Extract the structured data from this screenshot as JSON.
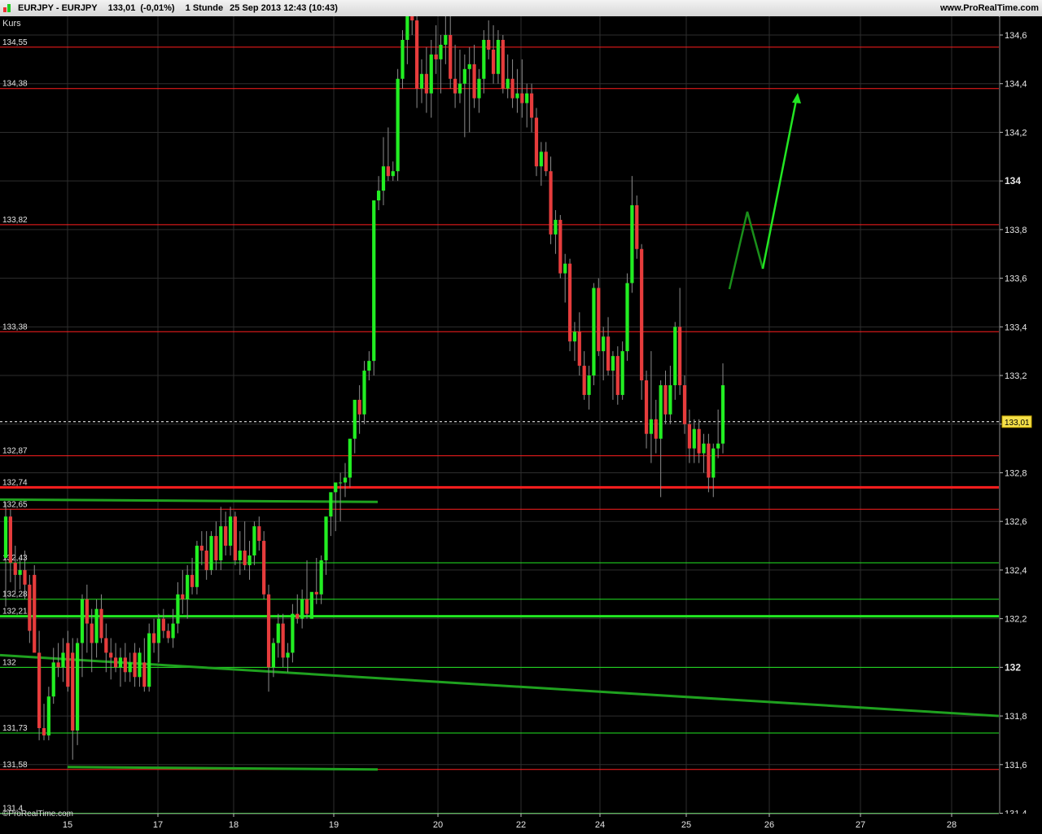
{
  "header": {
    "instrument": "EURJPY - EURJPY",
    "last": "133,01",
    "change": "(-0,01%)",
    "timeframe": "1 Stunde",
    "datetime": "25 Sep 2013 12:43 (10:43)",
    "site": "www.ProRealTime.com"
  },
  "watermark": "©ProRealTime.com",
  "chart_data": {
    "type": "candlestick",
    "title": "EURJPY - EURJPY",
    "ylabel": "Kurs",
    "ylim": [
      131.4,
      134.7
    ],
    "grid": true,
    "y_ticks": [
      {
        "value": 131.4,
        "label": "131,4"
      },
      {
        "value": 131.6,
        "label": "131,6"
      },
      {
        "value": 131.8,
        "label": "131,8"
      },
      {
        "value": 132.0,
        "label": "132",
        "bold": true
      },
      {
        "value": 132.2,
        "label": "132,2"
      },
      {
        "value": 132.4,
        "label": "132,4"
      },
      {
        "value": 132.6,
        "label": "132,6"
      },
      {
        "value": 132.8,
        "label": "132,8"
      },
      {
        "value": 133.0,
        "label": "133"
      },
      {
        "value": 133.2,
        "label": "133,2"
      },
      {
        "value": 133.4,
        "label": "133,4"
      },
      {
        "value": 133.6,
        "label": "133,6"
      },
      {
        "value": 133.8,
        "label": "133,8"
      },
      {
        "value": 134.0,
        "label": "134",
        "bold": true
      },
      {
        "value": 134.2,
        "label": "134,2"
      },
      {
        "value": 134.4,
        "label": "134,4"
      },
      {
        "value": 134.6,
        "label": "134,6"
      }
    ],
    "x_labels": [
      "15",
      "17",
      "18",
      "19",
      "20",
      "22",
      "24",
      "25",
      "26",
      "27",
      "28"
    ],
    "current_price": {
      "value": 133.01,
      "label": "133,01"
    },
    "levels": [
      {
        "value": 134.55,
        "label": "134,55",
        "color": "#ff1e1e",
        "width": 1
      },
      {
        "value": 134.38,
        "label": "134,38",
        "color": "#ff1e1e",
        "width": 1
      },
      {
        "value": 133.82,
        "label": "133,82",
        "color": "#ff1e1e",
        "width": 1
      },
      {
        "value": 133.38,
        "label": "133,38",
        "color": "#ff1e1e",
        "width": 1
      },
      {
        "value": 132.87,
        "label": "132,87",
        "color": "#ff1e1e",
        "width": 1
      },
      {
        "value": 132.74,
        "label": "132,74",
        "color": "#ff1e1e",
        "width": 3
      },
      {
        "value": 132.65,
        "label": "132,65",
        "color": "#ff1e1e",
        "width": 1
      },
      {
        "value": 132.43,
        "label": "132,43",
        "color": "#22e622",
        "width": 1
      },
      {
        "value": 132.28,
        "label": "132,28",
        "color": "#22e622",
        "width": 1
      },
      {
        "value": 132.21,
        "label": "132,21",
        "color": "#22e622",
        "width": 3
      },
      {
        "value": 132.0,
        "label": "132",
        "color": "#22e622",
        "width": 1
      },
      {
        "value": 131.73,
        "label": "131,73",
        "color": "#22e622",
        "width": 1
      },
      {
        "value": 131.58,
        "label": "131,58",
        "color": "#ff1e1e",
        "width": 1
      },
      {
        "value": 131.4,
        "label": "131,4",
        "color": "#22e622",
        "width": 1
      }
    ],
    "trendlines": [
      {
        "from": [
          "15",
          132.69
        ],
        "to": [
          "19",
          132.68
        ],
        "color": "#1fa11f",
        "width": 3
      },
      {
        "from": [
          "15",
          131.59
        ],
        "to": [
          "19",
          131.58
        ],
        "color": "#1fa11f",
        "width": 3
      },
      {
        "from": [
          "15",
          132.05
        ],
        "to": [
          "28",
          131.8
        ],
        "color": "#1fa11f",
        "width": 3
      }
    ],
    "annotations": [
      {
        "type": "projection_path",
        "points": [
          [
            "25",
            133.62
          ],
          [
            "26",
            133.94
          ],
          [
            "26",
            133.7
          ]
        ],
        "color": "#1a8f1a"
      },
      {
        "type": "arrow",
        "from": [
          "26",
          133.7
        ],
        "to": [
          "26",
          134.45
        ],
        "color": "#22e622"
      }
    ],
    "candles": [
      {
        "o": 132.45,
        "h": 132.68,
        "l": 132.25,
        "c": 132.62
      },
      {
        "o": 132.62,
        "h": 132.65,
        "l": 132.35,
        "c": 132.43
      },
      {
        "o": 132.43,
        "h": 132.5,
        "l": 132.3,
        "c": 132.38
      },
      {
        "o": 132.38,
        "h": 132.45,
        "l": 132.32,
        "c": 132.4
      },
      {
        "o": 132.4,
        "h": 132.48,
        "l": 132.28,
        "c": 132.34
      },
      {
        "o": 132.34,
        "h": 132.38,
        "l": 132.1,
        "c": 132.15
      },
      {
        "o": 132.38,
        "h": 132.42,
        "l": 132.08,
        "c": 132.06
      },
      {
        "o": 132.06,
        "h": 132.15,
        "l": 131.7,
        "c": 131.75
      },
      {
        "o": 131.75,
        "h": 131.85,
        "l": 131.7,
        "c": 131.72
      },
      {
        "o": 131.72,
        "h": 131.92,
        "l": 131.7,
        "c": 131.88
      },
      {
        "o": 131.88,
        "h": 132.08,
        "l": 131.85,
        "c": 132.02
      },
      {
        "o": 132.02,
        "h": 132.1,
        "l": 131.96,
        "c": 132.0
      },
      {
        "o": 132.0,
        "h": 132.12,
        "l": 131.94,
        "c": 132.06
      },
      {
        "o": 132.1,
        "h": 132.15,
        "l": 131.9,
        "c": 131.92
      },
      {
        "o": 132.06,
        "h": 132.12,
        "l": 131.62,
        "c": 131.74
      },
      {
        "o": 131.74,
        "h": 132.12,
        "l": 131.68,
        "c": 132.1
      },
      {
        "o": 132.1,
        "h": 132.3,
        "l": 131.96,
        "c": 132.28
      },
      {
        "o": 132.28,
        "h": 132.34,
        "l": 132.06,
        "c": 132.18
      },
      {
        "o": 132.18,
        "h": 132.24,
        "l": 131.98,
        "c": 132.1
      },
      {
        "o": 132.1,
        "h": 132.28,
        "l": 132.04,
        "c": 132.24
      },
      {
        "o": 132.24,
        "h": 132.3,
        "l": 132.1,
        "c": 132.12
      },
      {
        "o": 132.12,
        "h": 132.18,
        "l": 131.98,
        "c": 132.06
      },
      {
        "o": 132.06,
        "h": 132.12,
        "l": 131.95,
        "c": 132.04
      },
      {
        "o": 132.04,
        "h": 132.1,
        "l": 131.98,
        "c": 132.0
      },
      {
        "o": 132.0,
        "h": 132.08,
        "l": 131.92,
        "c": 132.04
      },
      {
        "o": 132.04,
        "h": 132.1,
        "l": 131.94,
        "c": 131.98
      },
      {
        "o": 131.98,
        "h": 132.06,
        "l": 131.94,
        "c": 132.02
      },
      {
        "o": 132.06,
        "h": 132.1,
        "l": 131.92,
        "c": 131.96
      },
      {
        "o": 131.96,
        "h": 132.08,
        "l": 131.92,
        "c": 132.06
      },
      {
        "o": 132.02,
        "h": 132.12,
        "l": 131.9,
        "c": 131.92
      },
      {
        "o": 131.92,
        "h": 132.18,
        "l": 131.9,
        "c": 132.14
      },
      {
        "o": 132.14,
        "h": 132.2,
        "l": 132.06,
        "c": 132.1
      },
      {
        "o": 132.1,
        "h": 132.22,
        "l": 132.02,
        "c": 132.2
      },
      {
        "o": 132.2,
        "h": 132.24,
        "l": 132.12,
        "c": 132.15
      },
      {
        "o": 132.15,
        "h": 132.18,
        "l": 132.1,
        "c": 132.12
      },
      {
        "o": 132.12,
        "h": 132.24,
        "l": 132.08,
        "c": 132.18
      },
      {
        "o": 132.18,
        "h": 132.35,
        "l": 132.14,
        "c": 132.3
      },
      {
        "o": 132.3,
        "h": 132.4,
        "l": 132.22,
        "c": 132.28
      },
      {
        "o": 132.28,
        "h": 132.42,
        "l": 132.2,
        "c": 132.38
      },
      {
        "o": 132.38,
        "h": 132.45,
        "l": 132.3,
        "c": 132.33
      },
      {
        "o": 132.33,
        "h": 132.52,
        "l": 132.3,
        "c": 132.5
      },
      {
        "o": 132.5,
        "h": 132.56,
        "l": 132.42,
        "c": 132.48
      },
      {
        "o": 132.48,
        "h": 132.56,
        "l": 132.36,
        "c": 132.4
      },
      {
        "o": 132.4,
        "h": 132.56,
        "l": 132.38,
        "c": 132.54
      },
      {
        "o": 132.54,
        "h": 132.6,
        "l": 132.4,
        "c": 132.44
      },
      {
        "o": 132.44,
        "h": 132.66,
        "l": 132.4,
        "c": 132.58
      },
      {
        "o": 132.58,
        "h": 132.64,
        "l": 132.46,
        "c": 132.5
      },
      {
        "o": 132.5,
        "h": 132.66,
        "l": 132.46,
        "c": 132.62
      },
      {
        "o": 132.62,
        "h": 132.64,
        "l": 132.42,
        "c": 132.44
      },
      {
        "o": 132.44,
        "h": 132.56,
        "l": 132.38,
        "c": 132.48
      },
      {
        "o": 132.48,
        "h": 132.6,
        "l": 132.4,
        "c": 132.42
      },
      {
        "o": 132.42,
        "h": 132.52,
        "l": 132.36,
        "c": 132.46
      },
      {
        "o": 132.46,
        "h": 132.6,
        "l": 132.42,
        "c": 132.58
      },
      {
        "o": 132.58,
        "h": 132.62,
        "l": 132.48,
        "c": 132.52
      },
      {
        "o": 132.52,
        "h": 132.56,
        "l": 132.28,
        "c": 132.3
      },
      {
        "o": 132.3,
        "h": 132.34,
        "l": 131.9,
        "c": 132.0
      },
      {
        "o": 132.0,
        "h": 132.12,
        "l": 131.96,
        "c": 132.1
      },
      {
        "o": 132.1,
        "h": 132.22,
        "l": 132.04,
        "c": 132.18
      },
      {
        "o": 132.18,
        "h": 132.22,
        "l": 132.0,
        "c": 132.04
      },
      {
        "o": 132.04,
        "h": 132.1,
        "l": 131.98,
        "c": 132.06
      },
      {
        "o": 132.06,
        "h": 132.26,
        "l": 132.02,
        "c": 132.22
      },
      {
        "o": 132.22,
        "h": 132.3,
        "l": 132.18,
        "c": 132.2
      },
      {
        "o": 132.2,
        "h": 132.32,
        "l": 132.16,
        "c": 132.28
      },
      {
        "o": 132.28,
        "h": 132.44,
        "l": 132.2,
        "c": 132.22
      },
      {
        "o": 132.2,
        "h": 132.3,
        "l": 132.2,
        "c": 132.31
      },
      {
        "o": 132.31,
        "h": 132.45,
        "l": 132.26,
        "c": 132.3
      },
      {
        "o": 132.3,
        "h": 132.46,
        "l": 132.26,
        "c": 132.44
      },
      {
        "o": 132.44,
        "h": 132.6,
        "l": 132.38,
        "c": 132.62
      },
      {
        "o": 132.62,
        "h": 132.7,
        "l": 132.54,
        "c": 132.72
      },
      {
        "o": 132.72,
        "h": 132.74,
        "l": 132.56,
        "c": 132.76
      },
      {
        "o": 132.76,
        "h": 132.8,
        "l": 132.6,
        "c": 132.76
      },
      {
        "o": 132.76,
        "h": 132.84,
        "l": 132.7,
        "c": 132.78
      },
      {
        "o": 132.78,
        "h": 132.9,
        "l": 132.74,
        "c": 132.94
      },
      {
        "o": 132.94,
        "h": 133.04,
        "l": 132.88,
        "c": 133.1
      },
      {
        "o": 133.1,
        "h": 133.16,
        "l": 132.96,
        "c": 133.04
      },
      {
        "o": 133.04,
        "h": 133.26,
        "l": 133.0,
        "c": 133.22
      },
      {
        "o": 133.22,
        "h": 133.3,
        "l": 133.18,
        "c": 133.26
      },
      {
        "o": 133.26,
        "h": 133.92,
        "l": 133.2,
        "c": 133.92
      },
      {
        "o": 133.92,
        "h": 134.02,
        "l": 133.88,
        "c": 133.96
      },
      {
        "o": 133.96,
        "h": 134.18,
        "l": 133.9,
        "c": 134.06
      },
      {
        "o": 134.06,
        "h": 134.22,
        "l": 134.0,
        "c": 134.02
      },
      {
        "o": 134.02,
        "h": 134.08,
        "l": 134.0,
        "c": 134.04
      },
      {
        "o": 134.04,
        "h": 134.46,
        "l": 134.0,
        "c": 134.42
      },
      {
        "o": 134.42,
        "h": 134.62,
        "l": 134.38,
        "c": 134.58
      },
      {
        "o": 134.58,
        "h": 134.7,
        "l": 134.48,
        "c": 134.68
      },
      {
        "o": 134.68,
        "h": 134.72,
        "l": 134.6,
        "c": 134.66
      },
      {
        "o": 134.66,
        "h": 134.7,
        "l": 134.3,
        "c": 134.38
      },
      {
        "o": 134.38,
        "h": 134.5,
        "l": 134.32,
        "c": 134.44
      },
      {
        "o": 134.44,
        "h": 134.55,
        "l": 134.28,
        "c": 134.36
      },
      {
        "o": 134.36,
        "h": 134.58,
        "l": 134.26,
        "c": 134.52
      },
      {
        "o": 134.52,
        "h": 134.64,
        "l": 134.44,
        "c": 134.5
      },
      {
        "o": 134.5,
        "h": 134.6,
        "l": 134.36,
        "c": 134.56
      },
      {
        "o": 134.56,
        "h": 134.7,
        "l": 134.48,
        "c": 134.6
      },
      {
        "o": 134.6,
        "h": 134.72,
        "l": 134.38,
        "c": 134.42
      },
      {
        "o": 134.42,
        "h": 134.56,
        "l": 134.3,
        "c": 134.36
      },
      {
        "o": 134.36,
        "h": 134.54,
        "l": 134.32,
        "c": 134.4
      },
      {
        "o": 134.4,
        "h": 134.52,
        "l": 134.18,
        "c": 134.46
      },
      {
        "o": 134.46,
        "h": 134.55,
        "l": 134.2,
        "c": 134.48
      },
      {
        "o": 134.48,
        "h": 134.56,
        "l": 134.3,
        "c": 134.34
      },
      {
        "o": 134.34,
        "h": 134.46,
        "l": 134.28,
        "c": 134.42
      },
      {
        "o": 134.42,
        "h": 134.62,
        "l": 134.36,
        "c": 134.58
      },
      {
        "o": 134.58,
        "h": 134.66,
        "l": 134.5,
        "c": 134.54
      },
      {
        "o": 134.54,
        "h": 134.64,
        "l": 134.4,
        "c": 134.44
      },
      {
        "o": 134.44,
        "h": 134.62,
        "l": 134.4,
        "c": 134.58
      },
      {
        "o": 134.58,
        "h": 134.6,
        "l": 134.36,
        "c": 134.38
      },
      {
        "o": 134.38,
        "h": 134.52,
        "l": 134.34,
        "c": 134.42
      },
      {
        "o": 134.42,
        "h": 134.5,
        "l": 134.3,
        "c": 134.34
      },
      {
        "o": 134.34,
        "h": 134.46,
        "l": 134.28,
        "c": 134.36
      },
      {
        "o": 134.36,
        "h": 134.5,
        "l": 134.26,
        "c": 134.32
      },
      {
        "o": 134.32,
        "h": 134.4,
        "l": 134.22,
        "c": 134.36
      },
      {
        "o": 134.36,
        "h": 134.4,
        "l": 134.2,
        "c": 134.26
      },
      {
        "o": 134.26,
        "h": 134.3,
        "l": 134.02,
        "c": 134.06
      },
      {
        "o": 134.06,
        "h": 134.16,
        "l": 133.98,
        "c": 134.12
      },
      {
        "o": 134.12,
        "h": 134.16,
        "l": 134.02,
        "c": 134.04
      },
      {
        "o": 134.04,
        "h": 134.1,
        "l": 133.74,
        "c": 133.78
      },
      {
        "o": 133.78,
        "h": 133.88,
        "l": 133.7,
        "c": 133.84
      },
      {
        "o": 133.84,
        "h": 133.86,
        "l": 133.6,
        "c": 133.62
      },
      {
        "o": 133.62,
        "h": 133.7,
        "l": 133.5,
        "c": 133.66
      },
      {
        "o": 133.66,
        "h": 133.68,
        "l": 133.3,
        "c": 133.34
      },
      {
        "o": 133.34,
        "h": 133.42,
        "l": 133.26,
        "c": 133.38
      },
      {
        "o": 133.38,
        "h": 133.46,
        "l": 133.2,
        "c": 133.24
      },
      {
        "o": 133.24,
        "h": 133.3,
        "l": 133.1,
        "c": 133.12
      },
      {
        "o": 133.12,
        "h": 133.24,
        "l": 133.06,
        "c": 133.2
      },
      {
        "o": 133.2,
        "h": 133.58,
        "l": 133.16,
        "c": 133.56
      },
      {
        "o": 133.56,
        "h": 133.6,
        "l": 133.28,
        "c": 133.3
      },
      {
        "o": 133.3,
        "h": 133.4,
        "l": 133.18,
        "c": 133.36
      },
      {
        "o": 133.36,
        "h": 133.44,
        "l": 133.2,
        "c": 133.22
      },
      {
        "o": 133.22,
        "h": 133.3,
        "l": 133.1,
        "c": 133.28
      },
      {
        "o": 133.28,
        "h": 133.32,
        "l": 133.08,
        "c": 133.12
      },
      {
        "o": 133.12,
        "h": 133.34,
        "l": 133.1,
        "c": 133.3
      },
      {
        "o": 133.3,
        "h": 133.62,
        "l": 133.26,
        "c": 133.58
      },
      {
        "o": 133.58,
        "h": 134.02,
        "l": 133.54,
        "c": 133.9
      },
      {
        "o": 133.9,
        "h": 133.94,
        "l": 133.68,
        "c": 133.72
      },
      {
        "o": 133.72,
        "h": 133.74,
        "l": 133.1,
        "c": 133.18
      },
      {
        "o": 133.18,
        "h": 133.22,
        "l": 132.9,
        "c": 132.96
      },
      {
        "o": 132.96,
        "h": 133.3,
        "l": 132.84,
        "c": 133.02
      },
      {
        "o": 133.02,
        "h": 133.1,
        "l": 132.88,
        "c": 132.94
      },
      {
        "o": 132.94,
        "h": 133.18,
        "l": 132.7,
        "c": 133.16
      },
      {
        "o": 133.16,
        "h": 133.22,
        "l": 133.0,
        "c": 133.04
      },
      {
        "o": 133.04,
        "h": 133.24,
        "l": 133.0,
        "c": 133.16
      },
      {
        "o": 133.16,
        "h": 133.42,
        "l": 133.1,
        "c": 133.4
      },
      {
        "o": 133.4,
        "h": 133.56,
        "l": 133.12,
        "c": 133.16
      },
      {
        "o": 133.16,
        "h": 133.2,
        "l": 132.96,
        "c": 133.0
      },
      {
        "o": 133.0,
        "h": 133.06,
        "l": 132.84,
        "c": 132.9
      },
      {
        "o": 132.9,
        "h": 133.02,
        "l": 132.84,
        "c": 132.98
      },
      {
        "o": 132.98,
        "h": 133.02,
        "l": 132.84,
        "c": 132.88
      },
      {
        "o": 132.88,
        "h": 132.96,
        "l": 132.8,
        "c": 132.92
      },
      {
        "o": 132.92,
        "h": 132.96,
        "l": 132.72,
        "c": 132.78
      },
      {
        "o": 132.78,
        "h": 132.92,
        "l": 132.7,
        "c": 132.9
      },
      {
        "o": 132.9,
        "h": 133.06,
        "l": 132.86,
        "c": 132.92
      },
      {
        "o": 132.92,
        "h": 133.25,
        "l": 132.88,
        "c": 133.16
      }
    ]
  }
}
